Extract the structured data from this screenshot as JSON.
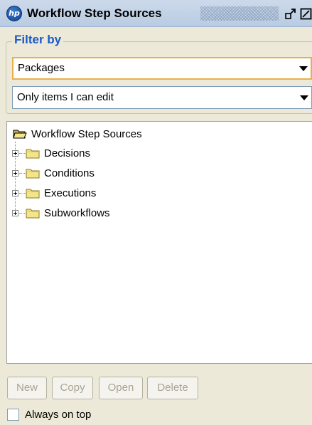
{
  "window": {
    "title": "Workflow Step Sources",
    "logo_text": "hp"
  },
  "filter": {
    "legend": "Filter by",
    "type_selected": "Packages",
    "scope_selected": "Only items I can edit"
  },
  "tree": {
    "root": {
      "label": "Workflow Step Sources",
      "icon": "open-folder-icon"
    },
    "children": [
      {
        "label": "Decisions",
        "icon": "folder-icon"
      },
      {
        "label": "Conditions",
        "icon": "folder-icon"
      },
      {
        "label": "Executions",
        "icon": "folder-icon"
      },
      {
        "label": "Subworkflows",
        "icon": "folder-icon"
      }
    ]
  },
  "buttons": {
    "new": "New",
    "copy": "Copy",
    "open": "Open",
    "delete": "Delete"
  },
  "options": {
    "always_on_top_label": "Always on top",
    "always_on_top_checked": false
  },
  "colors": {
    "title_bar": "#c4d4e8",
    "legend_text": "#1b5ac6",
    "focus_border": "#e8b04a",
    "folder": "#f4e48a",
    "disabled_text": "#a7a694"
  }
}
